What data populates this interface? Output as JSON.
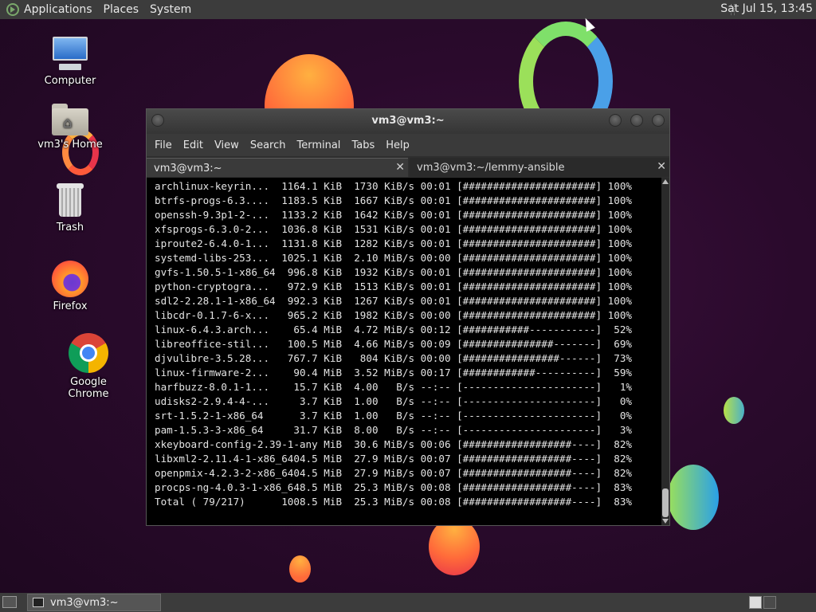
{
  "top_panel": {
    "menus": [
      "Applications",
      "Places",
      "System"
    ],
    "clock": "Sat Jul 15, 13:45"
  },
  "desktop_icons": [
    {
      "label": "Computer",
      "icon": "computer-icon"
    },
    {
      "label": "vm3's Home",
      "icon": "home-folder-icon"
    },
    {
      "label": "Trash",
      "icon": "trash-icon"
    },
    {
      "label": "Firefox",
      "icon": "firefox-icon"
    },
    {
      "label": "Google Chrome",
      "icon": "chrome-icon"
    }
  ],
  "terminal": {
    "title": "vm3@vm3:~",
    "menu": [
      "File",
      "Edit",
      "View",
      "Search",
      "Terminal",
      "Tabs",
      "Help"
    ],
    "tabs": [
      {
        "label": "vm3@vm3:~",
        "active": true
      },
      {
        "label": "vm3@vm3:~/lemmy-ansible",
        "active": false
      }
    ],
    "lines": [
      "archlinux-keyrin...  1164.1 KiB  1730 KiB/s 00:01 [######################] 100%",
      "btrfs-progs-6.3....  1183.5 KiB  1667 KiB/s 00:01 [######################] 100%",
      "openssh-9.3p1-2-...  1133.2 KiB  1642 KiB/s 00:01 [######################] 100%",
      "xfsprogs-6.3.0-2...  1036.8 KiB  1531 KiB/s 00:01 [######################] 100%",
      "iproute2-6.4.0-1...  1131.8 KiB  1282 KiB/s 00:01 [######################] 100%",
      "systemd-libs-253...  1025.1 KiB  2.10 MiB/s 00:00 [######################] 100%",
      "gvfs-1.50.5-1-x86_64  996.8 KiB  1932 KiB/s 00:01 [######################] 100%",
      "python-cryptogra...   972.9 KiB  1513 KiB/s 00:01 [######################] 100%",
      "sdl2-2.28.1-1-x86_64  992.3 KiB  1267 KiB/s 00:01 [######################] 100%",
      "libcdr-0.1.7-6-x...   965.2 KiB  1982 KiB/s 00:00 [######################] 100%",
      "linux-6.4.3.arch...    65.4 MiB  4.72 MiB/s 00:12 [###########-----------]  52%",
      "libreoffice-stil...   100.5 MiB  4.66 MiB/s 00:09 [###############-------]  69%",
      "djvulibre-3.5.28...   767.7 KiB   804 KiB/s 00:00 [################------]  73%",
      "linux-firmware-2...    90.4 MiB  3.52 MiB/s 00:17 [############----------]  59%",
      "harfbuzz-8.0.1-1...    15.7 KiB  4.00   B/s --:-- [----------------------]   1%",
      "udisks2-2.9.4-4-...     3.7 KiB  1.00   B/s --:-- [----------------------]   0%",
      "srt-1.5.2-1-x86_64      3.7 KiB  1.00   B/s --:-- [----------------------]   0%",
      "pam-1.5.3-3-x86_64     31.7 KiB  8.00   B/s --:-- [----------------------]   3%",
      "xkeyboard-config-2.39-1-any MiB  30.6 MiB/s 00:06 [##################----]  82%",
      "libxml2-2.11.4-1-x86_6404.5 MiB  27.9 MiB/s 00:07 [##################----]  82%",
      "openpmix-4.2.3-2-x86_6404.5 MiB  27.9 MiB/s 00:07 [##################----]  82%",
      "procps-ng-4.0.3-1-x86_648.5 MiB  25.3 MiB/s 00:08 [##################----]  83%",
      "Total ( 79/217)      1008.5 MiB  25.3 MiB/s 00:08 [##################----]  83%"
    ]
  },
  "bottom_panel": {
    "task": "vm3@vm3:~"
  }
}
